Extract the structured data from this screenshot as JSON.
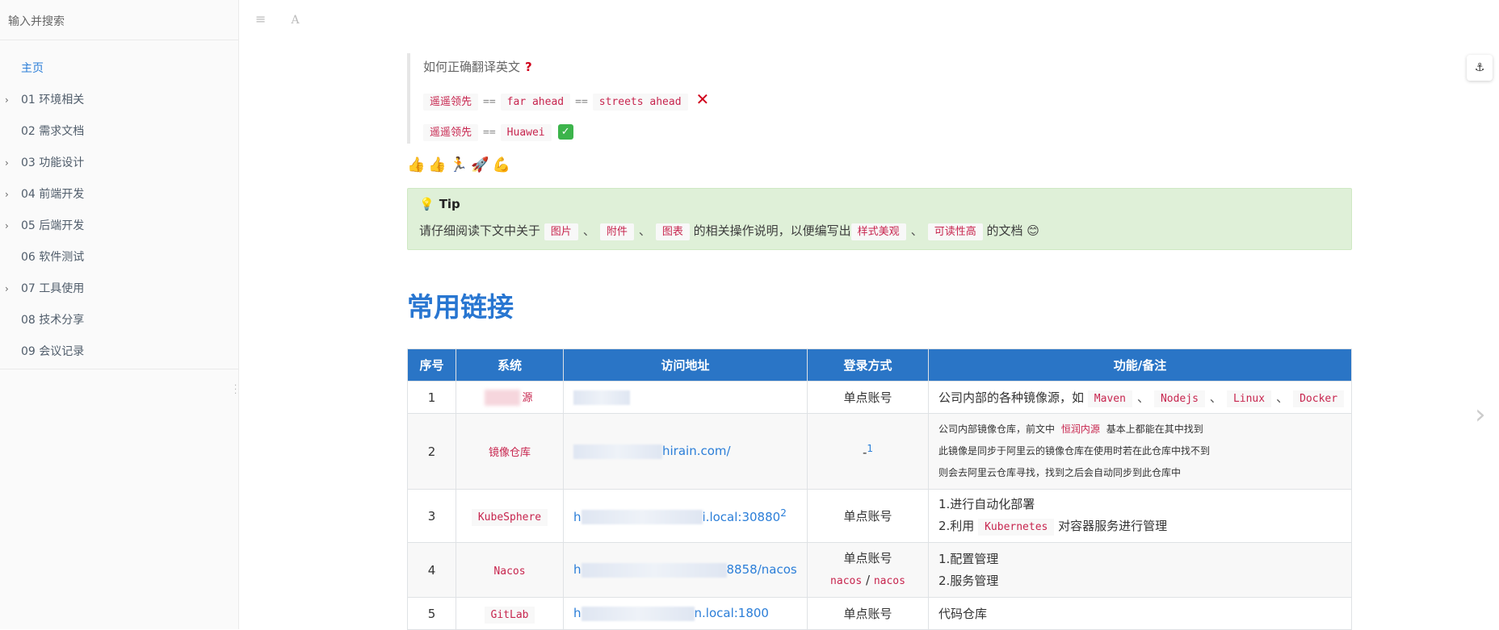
{
  "sidebar": {
    "search_placeholder": "输入并搜索",
    "items": [
      {
        "label": "主页",
        "expandable": false,
        "active": true
      },
      {
        "label": "01 环境相关",
        "expandable": true
      },
      {
        "label": "02 需求文档",
        "expandable": false
      },
      {
        "label": "03 功能设计",
        "expandable": true
      },
      {
        "label": "04 前端开发",
        "expandable": true
      },
      {
        "label": "05 后端开发",
        "expandable": true
      },
      {
        "label": "06 软件测试",
        "expandable": false
      },
      {
        "label": "07 工具使用",
        "expandable": true
      },
      {
        "label": "08 技术分享",
        "expandable": false
      },
      {
        "label": "09 会议记录",
        "expandable": false
      }
    ]
  },
  "toolbar": {
    "menu_icon": "≡",
    "font_icon": "A"
  },
  "anchor_icon": "⚓",
  "quote": {
    "question": "如何正确翻译英文",
    "line1": {
      "a": "遥遥领先",
      "op1": "==",
      "b": "far ahead",
      "op2": "==",
      "c": "streets ahead",
      "mark": "✕"
    },
    "line2": {
      "a": "遥遥领先",
      "op1": "==",
      "b": "Huawei",
      "mark": "✓"
    }
  },
  "emoji_row": "👍👍🏃🚀💪",
  "tip": {
    "title": "Tip",
    "text_prefix": "请仔细阅读下文中关于",
    "tag1": "图片",
    "tag2": "附件",
    "tag3": "图表",
    "text_middle": "的相关操作说明，以便编写出",
    "tag4": "样式美观",
    "tag5": "可读性高",
    "text_suffix": "的文档 😊"
  },
  "heading": "常用链接",
  "table": {
    "headers": [
      "序号",
      "系统",
      "访问地址",
      "登录方式",
      "功能/备注"
    ],
    "rows": [
      {
        "num": "1",
        "system": "源",
        "url": "",
        "login": "单点账号",
        "note": "公司内部的各种镜像源，如",
        "tags": [
          "Maven",
          "Nodejs",
          "Linux",
          "Docker"
        ]
      },
      {
        "num": "2",
        "system": "镜像仓库",
        "url": "hirain.com/",
        "login": "-",
        "login_sup": "1",
        "note_lines": [
          "公司内部镜像仓库，前文中",
          "恒润内源",
          "基本上都能在其中找到",
          "此镜像是同步于阿里云的镜像仓库在使用时若在此仓库中找不到",
          "则会去阿里云仓库寻找，找到之后会自动同步到此仓库中"
        ]
      },
      {
        "num": "3",
        "system": "KubeSphere",
        "url_prefix": "h",
        "url": "i.local:30880",
        "url_sup": "2",
        "login": "单点账号",
        "note_line1": "1.进行自动化部署",
        "note_line2_prefix": "2.利用",
        "note_line2_code": "Kubernetes",
        "note_line2_suffix": "对容器服务进行管理"
      },
      {
        "num": "4",
        "system": "Nacos",
        "url_prefix": "h",
        "url": "8858/nacos",
        "login": "单点账号",
        "login_user": "nacos",
        "login_sep": "/",
        "login_pass": "nacos",
        "note_line1": "1.配置管理",
        "note_line2": "2.服务管理"
      },
      {
        "num": "5",
        "system": "GitLab",
        "url_prefix": "h",
        "url": "n.local:1800",
        "login": "单点账号",
        "note": "代码仓库"
      }
    ]
  }
}
